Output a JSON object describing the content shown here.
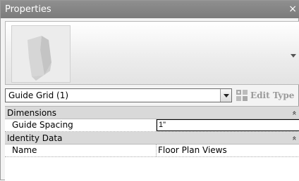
{
  "window": {
    "title": "Properties",
    "close_glyph": "×"
  },
  "type_preview": {
    "thumbnail": "type-thumbnail-icon",
    "dropdown": "dropdown-arrow-icon"
  },
  "type_selector": {
    "value": "Guide Grid (1)"
  },
  "edit_type": {
    "label": "Edit Type",
    "icon": "edit-type-icon"
  },
  "categories": [
    {
      "label": "Dimensions",
      "collapse_glyph": "»",
      "rows": [
        {
          "name": "Guide Spacing",
          "value": "1\""
        }
      ]
    },
    {
      "label": "Identity Data",
      "collapse_glyph": "»",
      "rows": [
        {
          "name": "Name",
          "value": "Floor Plan Views"
        }
      ]
    }
  ],
  "colors": {
    "title_bar": "#858585",
    "category_band": "#d9d9d9",
    "panel_bg": "#f3f3f3"
  }
}
